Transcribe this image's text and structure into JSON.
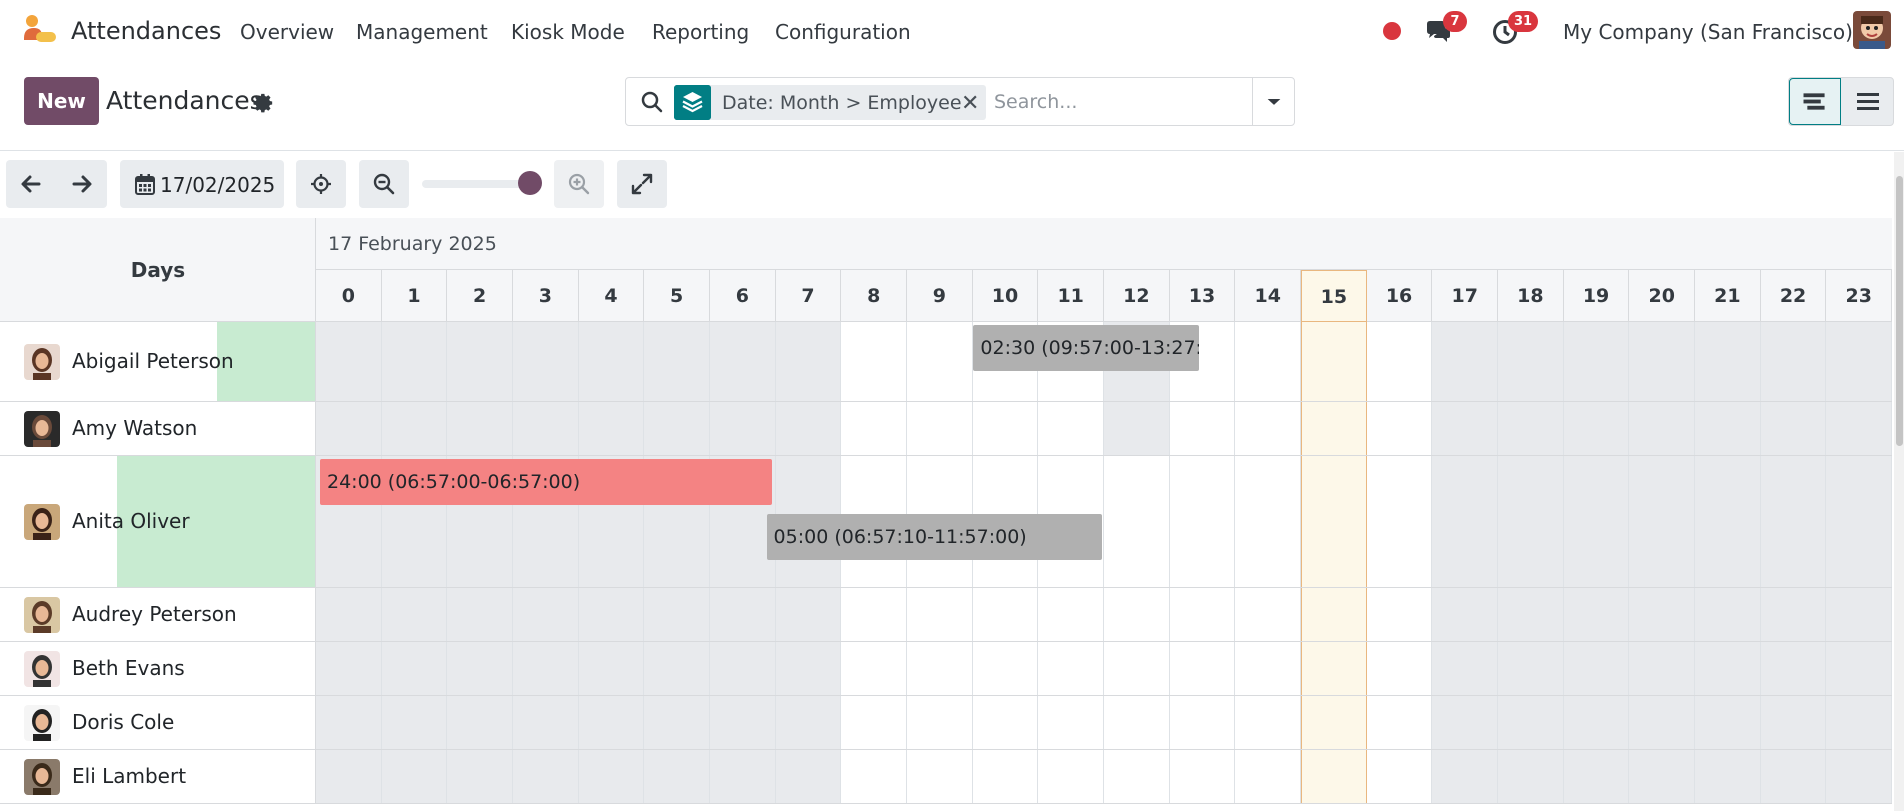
{
  "navbar": {
    "app_name": "Attendances",
    "menu": [
      "Overview",
      "Management",
      "Kiosk Mode",
      "Reporting",
      "Configuration"
    ],
    "messages_count": "7",
    "activities_count": "31",
    "company": "My Company (San Francisco)"
  },
  "control_panel": {
    "new_label": "New",
    "title": "Attendances",
    "facet_text": "Date: Month > Employee",
    "search_placeholder": "Search..."
  },
  "toolbar": {
    "date": "17/02/2025"
  },
  "gantt": {
    "row_header": "Days",
    "period_title": "17 February 2025",
    "hours": [
      "0",
      "1",
      "2",
      "3",
      "4",
      "5",
      "6",
      "7",
      "8",
      "9",
      "10",
      "11",
      "12",
      "13",
      "14",
      "15",
      "16",
      "17",
      "18",
      "19",
      "20",
      "21",
      "22",
      "23"
    ],
    "today_hour": 15,
    "off_hours": [
      0,
      1,
      2,
      3,
      4,
      5,
      6,
      7,
      17,
      18,
      19,
      20,
      21,
      22,
      23
    ],
    "rows": [
      {
        "name": "Abigail Peterson",
        "off_extra": [
          12
        ],
        "pills": [
          {
            "text": "02:30 (09:57:00-13:27:...",
            "start": 9.95,
            "end": 13.45,
            "color": "grey",
            "lane": 0
          }
        ]
      },
      {
        "name": "Amy Watson",
        "off_extra": [
          12
        ],
        "pills": []
      },
      {
        "name": "Anita Oliver",
        "off_extra": [],
        "pills": [
          {
            "text": "24:00 (06:57:00-06:57:00)",
            "start": 0.0,
            "end": 6.95,
            "color": "red",
            "lane": 0
          },
          {
            "text": "05:00 (06:57:10-11:57:00)",
            "start": 6.8,
            "end": 11.97,
            "color": "grey",
            "lane": 1
          }
        ]
      },
      {
        "name": "Audrey Peterson",
        "off_extra": [],
        "pills": []
      },
      {
        "name": "Beth Evans",
        "off_extra": [],
        "pills": []
      },
      {
        "name": "Doris Cole",
        "off_extra": [],
        "pills": []
      },
      {
        "name": "Eli Lambert",
        "off_extra": [],
        "pills": []
      }
    ]
  },
  "colors": {
    "brand": "#714b67",
    "teal": "#017e84",
    "badge": "#d9363e",
    "pill_grey": "#b0b0b0",
    "pill_red": "#f48383",
    "green_progress": "#c8ebd1"
  }
}
